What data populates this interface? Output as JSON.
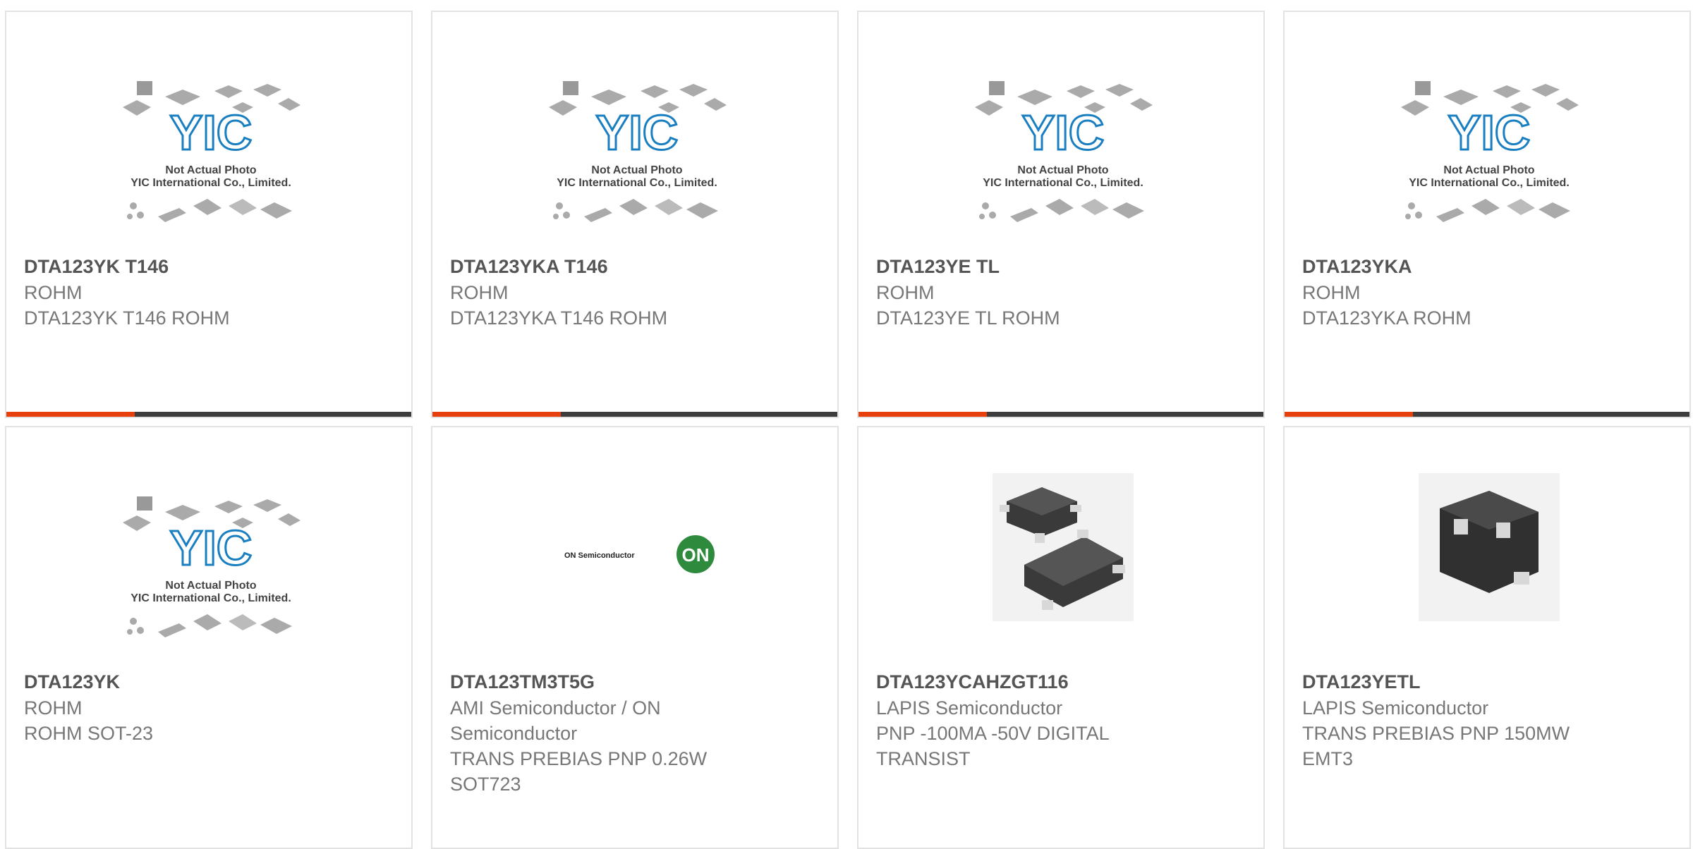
{
  "placeholder": {
    "brand": "YIC",
    "line1": "Not Actual Photo",
    "line2": "YIC International Co., Limited."
  },
  "on_logo": {
    "text": "ON Semiconductor",
    "badge": "ON"
  },
  "colors": {
    "accent": "#e8400c",
    "bar": "#3d3d3d",
    "logo_blue": "#1a7fc1",
    "on_green": "#2e8b3e"
  },
  "products": [
    {
      "part": "DTA123YK T146",
      "manufacturer": "ROHM",
      "desc": [
        "DTA123YK T146 ROHM"
      ],
      "image": "placeholder"
    },
    {
      "part": "DTA123YKA T146",
      "manufacturer": "ROHM",
      "desc": [
        "DTA123YKA T146 ROHM"
      ],
      "image": "placeholder"
    },
    {
      "part": "DTA123YE TL",
      "manufacturer": "ROHM",
      "desc": [
        "DTA123YE TL ROHM"
      ],
      "image": "placeholder"
    },
    {
      "part": "DTA123YKA",
      "manufacturer": "ROHM",
      "desc": [
        "DTA123YKA ROHM"
      ],
      "image": "placeholder"
    },
    {
      "part": "DTA123YK",
      "manufacturer": "ROHM",
      "desc": [
        "ROHM SOT-23"
      ],
      "image": "placeholder"
    },
    {
      "part": "DTA123TM3T5G",
      "manufacturer": [
        "AMI Semiconductor / ON",
        "Semiconductor"
      ],
      "desc": [
        "TRANS PREBIAS PNP 0.26W",
        "SOT723"
      ],
      "image": "on-logo"
    },
    {
      "part": "DTA123YCAHZGT116",
      "manufacturer": "LAPIS Semiconductor",
      "desc": [
        "PNP -100MA -50V DIGITAL",
        "TRANSIST"
      ],
      "image": "sot23-photo"
    },
    {
      "part": "DTA123YETL",
      "manufacturer": "LAPIS Semiconductor",
      "desc": [
        "TRANS PREBIAS PNP 150MW",
        "EMT3"
      ],
      "image": "emt3-photo"
    }
  ]
}
